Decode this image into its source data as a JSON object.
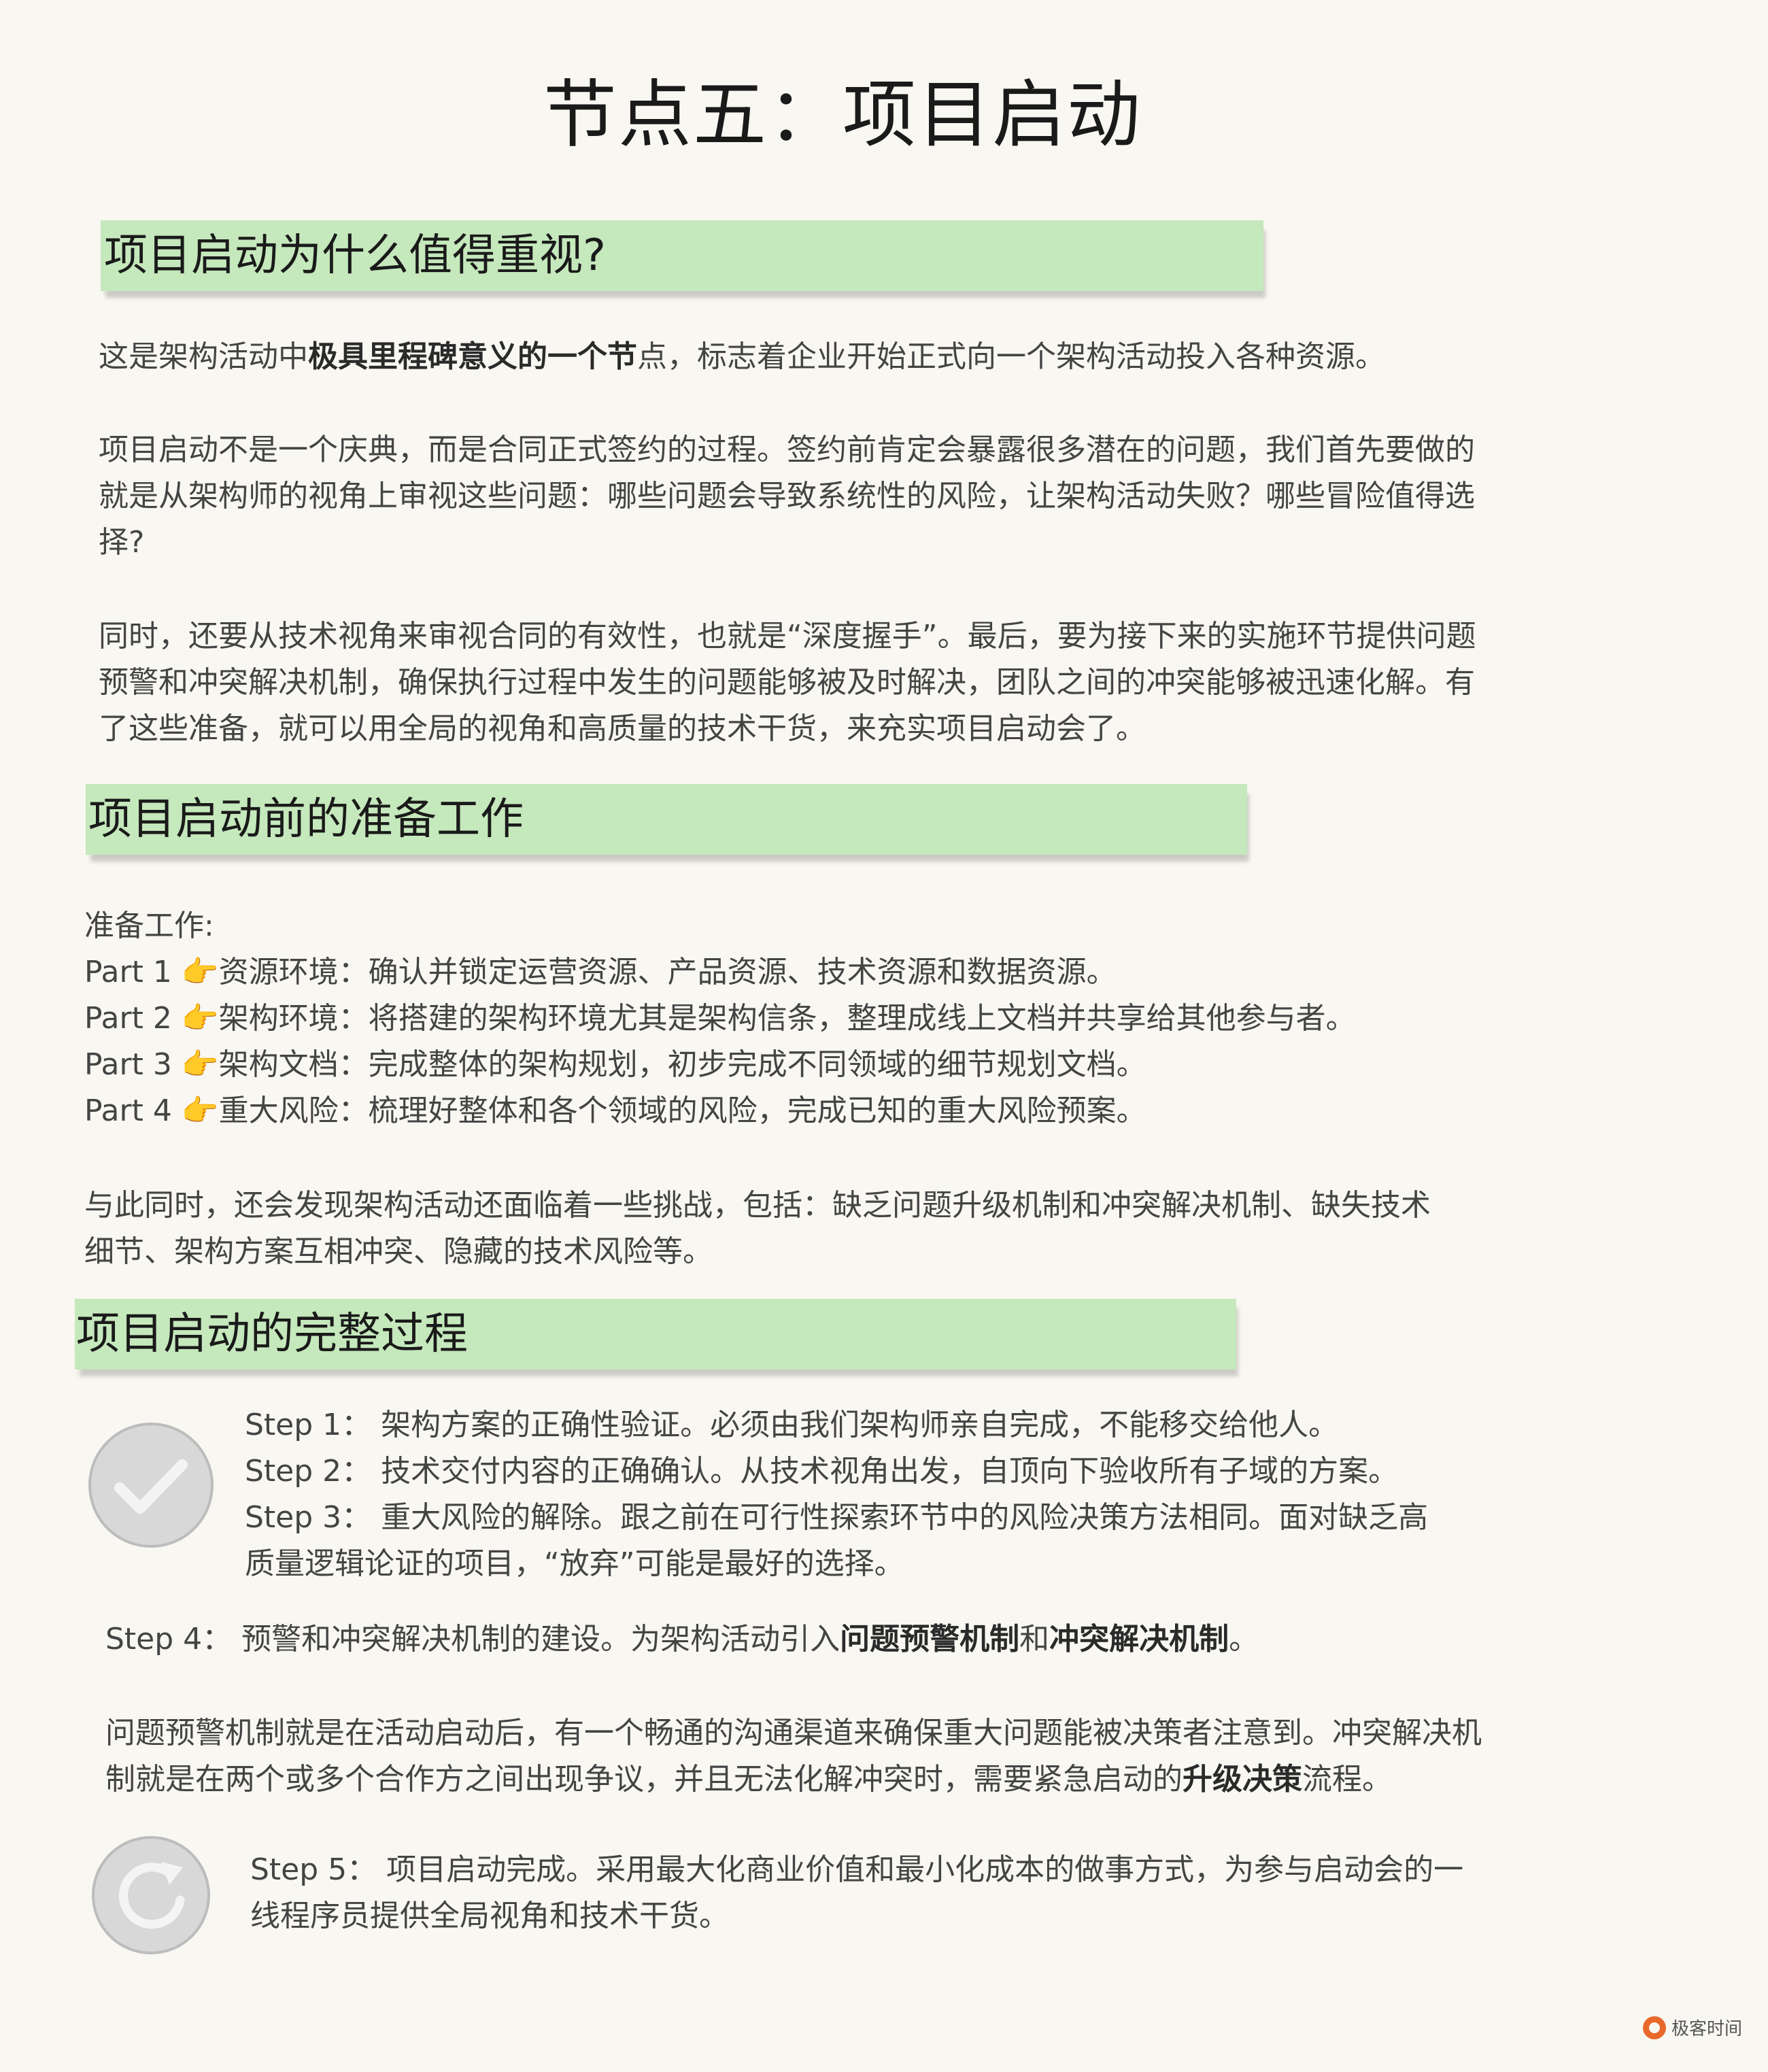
{
  "title": "节点五：项目启动",
  "section1": {
    "heading": "项目启动为什么值得重视?",
    "p1": {
      "a": "这是架构活动中",
      "b": "极具里程碑意义的一个节",
      "c": "点，标志着企业开始正式向一个架构活动投入各种资源。"
    },
    "p2": [
      "项目启动不是一个庆典，而是合同正式签约的过程。签约前肯定会暴露很多潜在的问题，我们首先要做的",
      "就是从架构师的视角上审视这些问题：哪些问题会导致系统性的风险，让架构活动失败？哪些冒险值得选",
      "择?"
    ],
    "p3": [
      "同时，还要从技术视角来审视合同的有效性，也就是“深度握手”。最后，要为接下来的实施环节提供问题",
      "预警和冲突解决机制，确保执行过程中发生的问题能够被及时解决，团队之间的冲突能够被迅速化解。有",
      "了这些准备，就可以用全局的视角和高质量的技术干货，来充实项目启动会了。"
    ]
  },
  "section2": {
    "heading": "项目启动前的准备工作",
    "intro": "准备工作:",
    "parts": [
      "Part  1 👉资源环境：确认并锁定运营资源、产品资源、技术资源和数据资源。",
      "Part 2 👉架构环境：将搭建的架构环境尤其是架构信条，整理成线上文档并共享给其他参与者。",
      "Part 3 👉架构文档：完成整体的架构规划，初步完成不同领域的细节规划文档。",
      "Part 4 👉重大风险：梳理好整体和各个领域的风险，完成已知的重大风险预案。"
    ],
    "challenges": [
      "与此同时，还会发现架构活动还面临着一些挑战，包括：缺乏问题升级机制和冲突解决机制、缺失技术",
      "细节、架构方案互相冲突、隐藏的技术风险等。"
    ]
  },
  "section3": {
    "heading": "项目启动的完整过程",
    "steps_a": [
      "Step  1： 架构方案的正确性验证。必须由我们架构师亲自完成，不能移交给他人。",
      "Step 2： 技术交付内容的正确确认。从技术视角出发，自顶向下验收所有子域的方案。",
      "Step 3： 重大风险的解除。跟之前在可行性探索环节中的风险决策方法相同。面对缺乏高",
      "质量逻辑论证的项目，“放弃”可能是最好的选择。"
    ],
    "step4": {
      "a": "Step 4： 预警和冲突解决机制的建设。为架构活动引入",
      "b": "问题预警机制",
      "c": "和",
      "d": "冲突解决机制",
      "e": "。"
    },
    "mech": {
      "line1": "问题预警机制就是在活动启动后，有一个畅通的沟通渠道来确保重大问题能被决策者注意到。冲突解决机",
      "line2_a": "制就是在两个或多个合作方之间出现争议，并且无法化解冲突时，需要紧急启动的",
      "line2_b": "升级决策",
      "line2_c": "流程。"
    },
    "step5": [
      "Step 5： 项目启动完成。采用最大化商业价值和最小化成本的做事方式，为参与启动会的一",
      "线程序员提供全局视角和技术干货。"
    ],
    "icons": [
      "checkmark-icon",
      "refresh-icon"
    ]
  },
  "logo": "极客时间",
  "colors": {
    "background": "#f9f7f1",
    "highlight": "#c5e8bc",
    "text": "#444444",
    "title": "#1a1a1a",
    "logo_accent": "#e9692c"
  }
}
